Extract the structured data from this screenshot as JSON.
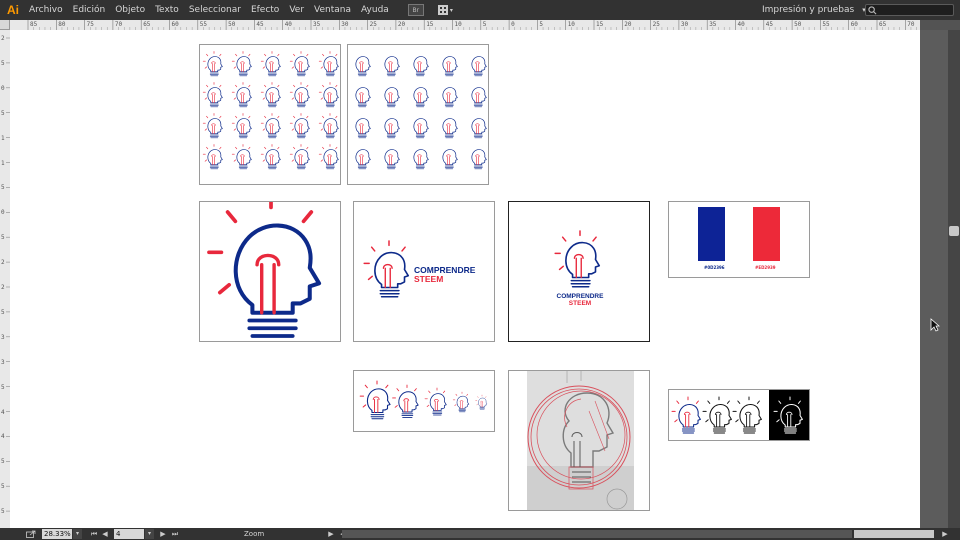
{
  "app": {
    "logo": "Ai",
    "logo_color": "#ff9a00"
  },
  "menu": [
    "Archivo",
    "Edición",
    "Objeto",
    "Texto",
    "Seleccionar",
    "Efecto",
    "Ver",
    "Ventana",
    "Ayuda"
  ],
  "toolbar": {
    "bridge_label": "Br"
  },
  "workspace": {
    "label": "Impresión y pruebas",
    "caret": "▾"
  },
  "search": {
    "placeholder": ""
  },
  "ruler_top": [
    "85",
    "80",
    "75",
    "70",
    "65",
    "60",
    "55",
    "50",
    "45",
    "40",
    "35",
    "30",
    "25",
    "20",
    "15",
    "10",
    "5",
    "0",
    "5",
    "10",
    "15",
    "20",
    "25",
    "30",
    "35",
    "40",
    "45",
    "50",
    "55",
    "60",
    "65",
    "70",
    "75"
  ],
  "ruler_left": [
    "2",
    "5",
    "0",
    "5",
    "1",
    "1",
    "5",
    "0",
    "5",
    "2",
    "2",
    "5",
    "3",
    "3",
    "5",
    "4",
    "4",
    "5",
    "5",
    "5"
  ],
  "artwork": {
    "brand_blue": "#0d2a8a",
    "brand_red": "#e8283c",
    "logo_line1": "COMPRENDRE",
    "logo_line2": "STEEM",
    "flag_blue_code": "#0D2396",
    "flag_red_code": "#ED2939",
    "flag_colors": [
      "#0d2396",
      "#ffffff",
      "#ed2939"
    ]
  },
  "status": {
    "zoom": "28.33%",
    "artboard_number": "4",
    "tool_label": "Zoom",
    "nav_first": "⏮",
    "nav_prev": "◀",
    "nav_next": "▶",
    "nav_last": "⏭",
    "drop": "▾"
  }
}
